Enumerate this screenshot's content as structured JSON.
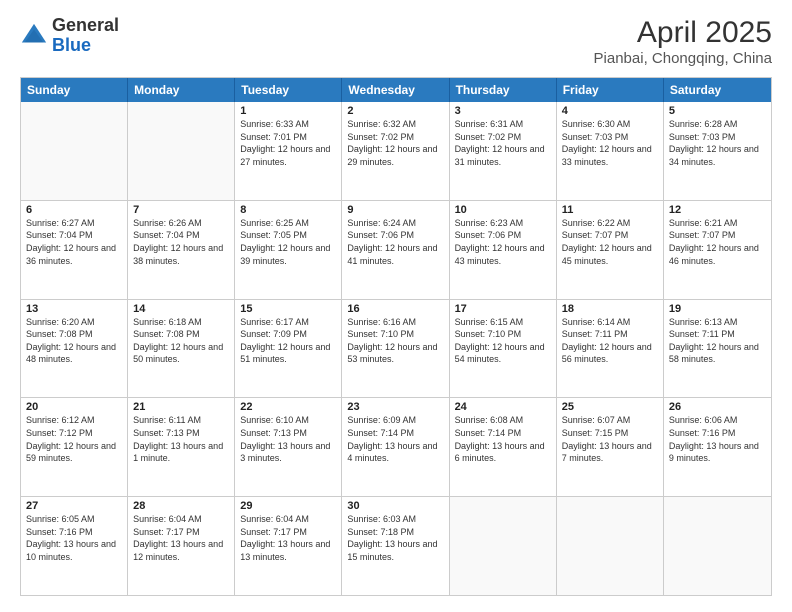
{
  "header": {
    "logo_general": "General",
    "logo_blue": "Blue",
    "main_title": "April 2025",
    "subtitle": "Pianbai, Chongqing, China"
  },
  "calendar": {
    "days_of_week": [
      "Sunday",
      "Monday",
      "Tuesday",
      "Wednesday",
      "Thursday",
      "Friday",
      "Saturday"
    ],
    "rows": [
      [
        {
          "day": "",
          "sunrise": "",
          "sunset": "",
          "daylight": ""
        },
        {
          "day": "",
          "sunrise": "",
          "sunset": "",
          "daylight": ""
        },
        {
          "day": "1",
          "sunrise": "Sunrise: 6:33 AM",
          "sunset": "Sunset: 7:01 PM",
          "daylight": "Daylight: 12 hours and 27 minutes."
        },
        {
          "day": "2",
          "sunrise": "Sunrise: 6:32 AM",
          "sunset": "Sunset: 7:02 PM",
          "daylight": "Daylight: 12 hours and 29 minutes."
        },
        {
          "day": "3",
          "sunrise": "Sunrise: 6:31 AM",
          "sunset": "Sunset: 7:02 PM",
          "daylight": "Daylight: 12 hours and 31 minutes."
        },
        {
          "day": "4",
          "sunrise": "Sunrise: 6:30 AM",
          "sunset": "Sunset: 7:03 PM",
          "daylight": "Daylight: 12 hours and 33 minutes."
        },
        {
          "day": "5",
          "sunrise": "Sunrise: 6:28 AM",
          "sunset": "Sunset: 7:03 PM",
          "daylight": "Daylight: 12 hours and 34 minutes."
        }
      ],
      [
        {
          "day": "6",
          "sunrise": "Sunrise: 6:27 AM",
          "sunset": "Sunset: 7:04 PM",
          "daylight": "Daylight: 12 hours and 36 minutes."
        },
        {
          "day": "7",
          "sunrise": "Sunrise: 6:26 AM",
          "sunset": "Sunset: 7:04 PM",
          "daylight": "Daylight: 12 hours and 38 minutes."
        },
        {
          "day": "8",
          "sunrise": "Sunrise: 6:25 AM",
          "sunset": "Sunset: 7:05 PM",
          "daylight": "Daylight: 12 hours and 39 minutes."
        },
        {
          "day": "9",
          "sunrise": "Sunrise: 6:24 AM",
          "sunset": "Sunset: 7:06 PM",
          "daylight": "Daylight: 12 hours and 41 minutes."
        },
        {
          "day": "10",
          "sunrise": "Sunrise: 6:23 AM",
          "sunset": "Sunset: 7:06 PM",
          "daylight": "Daylight: 12 hours and 43 minutes."
        },
        {
          "day": "11",
          "sunrise": "Sunrise: 6:22 AM",
          "sunset": "Sunset: 7:07 PM",
          "daylight": "Daylight: 12 hours and 45 minutes."
        },
        {
          "day": "12",
          "sunrise": "Sunrise: 6:21 AM",
          "sunset": "Sunset: 7:07 PM",
          "daylight": "Daylight: 12 hours and 46 minutes."
        }
      ],
      [
        {
          "day": "13",
          "sunrise": "Sunrise: 6:20 AM",
          "sunset": "Sunset: 7:08 PM",
          "daylight": "Daylight: 12 hours and 48 minutes."
        },
        {
          "day": "14",
          "sunrise": "Sunrise: 6:18 AM",
          "sunset": "Sunset: 7:08 PM",
          "daylight": "Daylight: 12 hours and 50 minutes."
        },
        {
          "day": "15",
          "sunrise": "Sunrise: 6:17 AM",
          "sunset": "Sunset: 7:09 PM",
          "daylight": "Daylight: 12 hours and 51 minutes."
        },
        {
          "day": "16",
          "sunrise": "Sunrise: 6:16 AM",
          "sunset": "Sunset: 7:10 PM",
          "daylight": "Daylight: 12 hours and 53 minutes."
        },
        {
          "day": "17",
          "sunrise": "Sunrise: 6:15 AM",
          "sunset": "Sunset: 7:10 PM",
          "daylight": "Daylight: 12 hours and 54 minutes."
        },
        {
          "day": "18",
          "sunrise": "Sunrise: 6:14 AM",
          "sunset": "Sunset: 7:11 PM",
          "daylight": "Daylight: 12 hours and 56 minutes."
        },
        {
          "day": "19",
          "sunrise": "Sunrise: 6:13 AM",
          "sunset": "Sunset: 7:11 PM",
          "daylight": "Daylight: 12 hours and 58 minutes."
        }
      ],
      [
        {
          "day": "20",
          "sunrise": "Sunrise: 6:12 AM",
          "sunset": "Sunset: 7:12 PM",
          "daylight": "Daylight: 12 hours and 59 minutes."
        },
        {
          "day": "21",
          "sunrise": "Sunrise: 6:11 AM",
          "sunset": "Sunset: 7:13 PM",
          "daylight": "Daylight: 13 hours and 1 minute."
        },
        {
          "day": "22",
          "sunrise": "Sunrise: 6:10 AM",
          "sunset": "Sunset: 7:13 PM",
          "daylight": "Daylight: 13 hours and 3 minutes."
        },
        {
          "day": "23",
          "sunrise": "Sunrise: 6:09 AM",
          "sunset": "Sunset: 7:14 PM",
          "daylight": "Daylight: 13 hours and 4 minutes."
        },
        {
          "day": "24",
          "sunrise": "Sunrise: 6:08 AM",
          "sunset": "Sunset: 7:14 PM",
          "daylight": "Daylight: 13 hours and 6 minutes."
        },
        {
          "day": "25",
          "sunrise": "Sunrise: 6:07 AM",
          "sunset": "Sunset: 7:15 PM",
          "daylight": "Daylight: 13 hours and 7 minutes."
        },
        {
          "day": "26",
          "sunrise": "Sunrise: 6:06 AM",
          "sunset": "Sunset: 7:16 PM",
          "daylight": "Daylight: 13 hours and 9 minutes."
        }
      ],
      [
        {
          "day": "27",
          "sunrise": "Sunrise: 6:05 AM",
          "sunset": "Sunset: 7:16 PM",
          "daylight": "Daylight: 13 hours and 10 minutes."
        },
        {
          "day": "28",
          "sunrise": "Sunrise: 6:04 AM",
          "sunset": "Sunset: 7:17 PM",
          "daylight": "Daylight: 13 hours and 12 minutes."
        },
        {
          "day": "29",
          "sunrise": "Sunrise: 6:04 AM",
          "sunset": "Sunset: 7:17 PM",
          "daylight": "Daylight: 13 hours and 13 minutes."
        },
        {
          "day": "30",
          "sunrise": "Sunrise: 6:03 AM",
          "sunset": "Sunset: 7:18 PM",
          "daylight": "Daylight: 13 hours and 15 minutes."
        },
        {
          "day": "",
          "sunrise": "",
          "sunset": "",
          "daylight": ""
        },
        {
          "day": "",
          "sunrise": "",
          "sunset": "",
          "daylight": ""
        },
        {
          "day": "",
          "sunrise": "",
          "sunset": "",
          "daylight": ""
        }
      ]
    ]
  }
}
